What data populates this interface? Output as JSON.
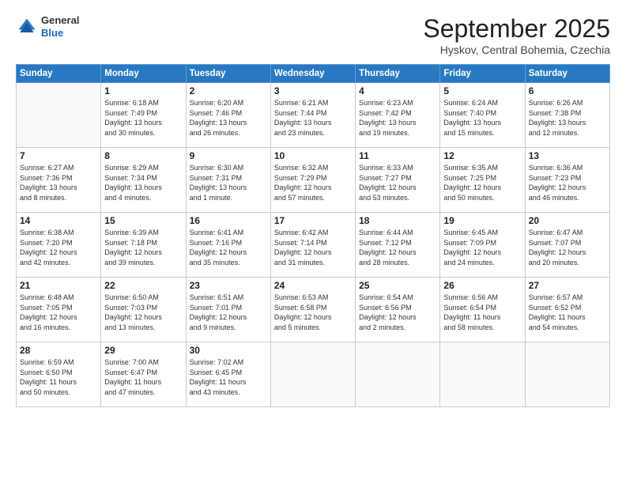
{
  "header": {
    "logo_line1": "General",
    "logo_line2": "Blue",
    "month_year": "September 2025",
    "location": "Hyskov, Central Bohemia, Czechia"
  },
  "weekdays": [
    "Sunday",
    "Monday",
    "Tuesday",
    "Wednesday",
    "Thursday",
    "Friday",
    "Saturday"
  ],
  "weeks": [
    [
      {
        "day": "",
        "detail": ""
      },
      {
        "day": "1",
        "detail": "Sunrise: 6:18 AM\nSunset: 7:49 PM\nDaylight: 13 hours\nand 30 minutes."
      },
      {
        "day": "2",
        "detail": "Sunrise: 6:20 AM\nSunset: 7:46 PM\nDaylight: 13 hours\nand 26 minutes."
      },
      {
        "day": "3",
        "detail": "Sunrise: 6:21 AM\nSunset: 7:44 PM\nDaylight: 13 hours\nand 23 minutes."
      },
      {
        "day": "4",
        "detail": "Sunrise: 6:23 AM\nSunset: 7:42 PM\nDaylight: 13 hours\nand 19 minutes."
      },
      {
        "day": "5",
        "detail": "Sunrise: 6:24 AM\nSunset: 7:40 PM\nDaylight: 13 hours\nand 15 minutes."
      },
      {
        "day": "6",
        "detail": "Sunrise: 6:26 AM\nSunset: 7:38 PM\nDaylight: 13 hours\nand 12 minutes."
      }
    ],
    [
      {
        "day": "7",
        "detail": "Sunrise: 6:27 AM\nSunset: 7:36 PM\nDaylight: 13 hours\nand 8 minutes."
      },
      {
        "day": "8",
        "detail": "Sunrise: 6:29 AM\nSunset: 7:34 PM\nDaylight: 13 hours\nand 4 minutes."
      },
      {
        "day": "9",
        "detail": "Sunrise: 6:30 AM\nSunset: 7:31 PM\nDaylight: 13 hours\nand 1 minute."
      },
      {
        "day": "10",
        "detail": "Sunrise: 6:32 AM\nSunset: 7:29 PM\nDaylight: 12 hours\nand 57 minutes."
      },
      {
        "day": "11",
        "detail": "Sunrise: 6:33 AM\nSunset: 7:27 PM\nDaylight: 12 hours\nand 53 minutes."
      },
      {
        "day": "12",
        "detail": "Sunrise: 6:35 AM\nSunset: 7:25 PM\nDaylight: 12 hours\nand 50 minutes."
      },
      {
        "day": "13",
        "detail": "Sunrise: 6:36 AM\nSunset: 7:23 PM\nDaylight: 12 hours\nand 46 minutes."
      }
    ],
    [
      {
        "day": "14",
        "detail": "Sunrise: 6:38 AM\nSunset: 7:20 PM\nDaylight: 12 hours\nand 42 minutes."
      },
      {
        "day": "15",
        "detail": "Sunrise: 6:39 AM\nSunset: 7:18 PM\nDaylight: 12 hours\nand 39 minutes."
      },
      {
        "day": "16",
        "detail": "Sunrise: 6:41 AM\nSunset: 7:16 PM\nDaylight: 12 hours\nand 35 minutes."
      },
      {
        "day": "17",
        "detail": "Sunrise: 6:42 AM\nSunset: 7:14 PM\nDaylight: 12 hours\nand 31 minutes."
      },
      {
        "day": "18",
        "detail": "Sunrise: 6:44 AM\nSunset: 7:12 PM\nDaylight: 12 hours\nand 28 minutes."
      },
      {
        "day": "19",
        "detail": "Sunrise: 6:45 AM\nSunset: 7:09 PM\nDaylight: 12 hours\nand 24 minutes."
      },
      {
        "day": "20",
        "detail": "Sunrise: 6:47 AM\nSunset: 7:07 PM\nDaylight: 12 hours\nand 20 minutes."
      }
    ],
    [
      {
        "day": "21",
        "detail": "Sunrise: 6:48 AM\nSunset: 7:05 PM\nDaylight: 12 hours\nand 16 minutes."
      },
      {
        "day": "22",
        "detail": "Sunrise: 6:50 AM\nSunset: 7:03 PM\nDaylight: 12 hours\nand 13 minutes."
      },
      {
        "day": "23",
        "detail": "Sunrise: 6:51 AM\nSunset: 7:01 PM\nDaylight: 12 hours\nand 9 minutes."
      },
      {
        "day": "24",
        "detail": "Sunrise: 6:53 AM\nSunset: 6:58 PM\nDaylight: 12 hours\nand 5 minutes."
      },
      {
        "day": "25",
        "detail": "Sunrise: 6:54 AM\nSunset: 6:56 PM\nDaylight: 12 hours\nand 2 minutes."
      },
      {
        "day": "26",
        "detail": "Sunrise: 6:56 AM\nSunset: 6:54 PM\nDaylight: 11 hours\nand 58 minutes."
      },
      {
        "day": "27",
        "detail": "Sunrise: 6:57 AM\nSunset: 6:52 PM\nDaylight: 11 hours\nand 54 minutes."
      }
    ],
    [
      {
        "day": "28",
        "detail": "Sunrise: 6:59 AM\nSunset: 6:50 PM\nDaylight: 11 hours\nand 50 minutes."
      },
      {
        "day": "29",
        "detail": "Sunrise: 7:00 AM\nSunset: 6:47 PM\nDaylight: 11 hours\nand 47 minutes."
      },
      {
        "day": "30",
        "detail": "Sunrise: 7:02 AM\nSunset: 6:45 PM\nDaylight: 11 hours\nand 43 minutes."
      },
      {
        "day": "",
        "detail": ""
      },
      {
        "day": "",
        "detail": ""
      },
      {
        "day": "",
        "detail": ""
      },
      {
        "day": "",
        "detail": ""
      }
    ]
  ]
}
